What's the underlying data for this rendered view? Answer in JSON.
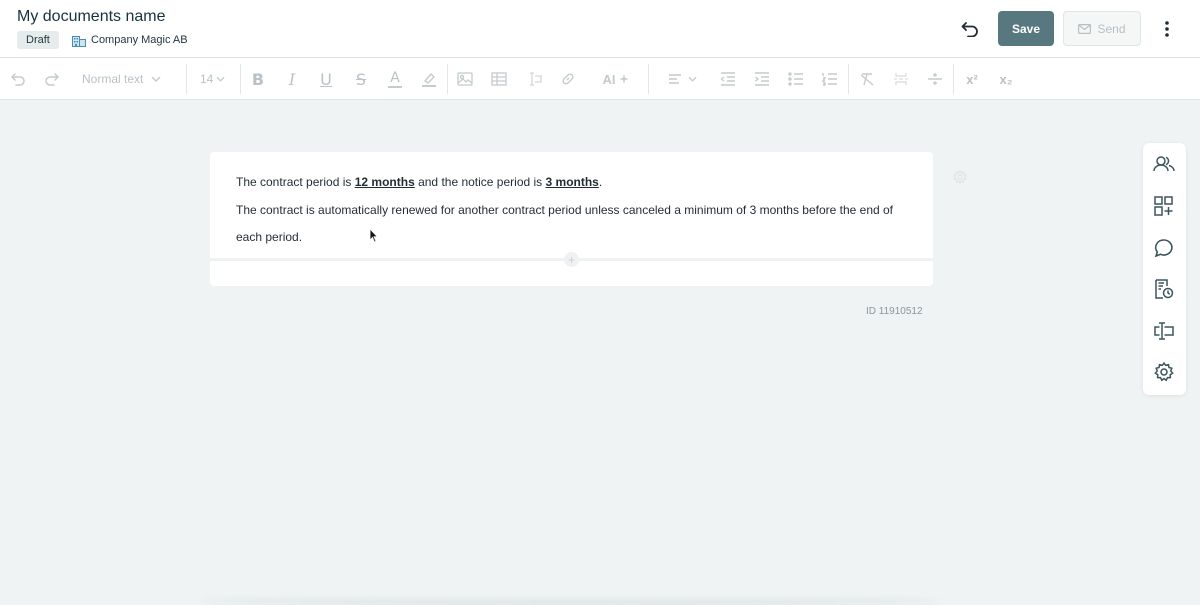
{
  "header": {
    "title": "My documents name",
    "status": "Draft",
    "company": "Company Magic AB",
    "save_label": "Save",
    "send_label": "Send"
  },
  "toolbar": {
    "text_style": "Normal text",
    "font_size": "14",
    "ai_label": "AI",
    "bold": "B",
    "italic": "I",
    "underline": "U",
    "strike": "S",
    "font_color": "A",
    "superscript": "x²",
    "subscript": "x₂"
  },
  "document": {
    "line1": {
      "pre": "The contract period is ",
      "b1": "12 months",
      "mid": " and the notice period is ",
      "b2": "3 months",
      "post": "."
    },
    "line2": "The contract is automatically renewed for another contract period unless canceled a minimum of 3 months before the end of",
    "line3": "each period.",
    "id_label": "ID 11910512"
  },
  "colors": {
    "accent": "#587880",
    "background": "#eff3f3",
    "icon": "#3c555d",
    "disabled": "#b9c2c6"
  },
  "side_panel": [
    "people-icon",
    "add-block-icon",
    "comment-icon",
    "document-history-icon",
    "text-field-icon",
    "settings-icon"
  ]
}
